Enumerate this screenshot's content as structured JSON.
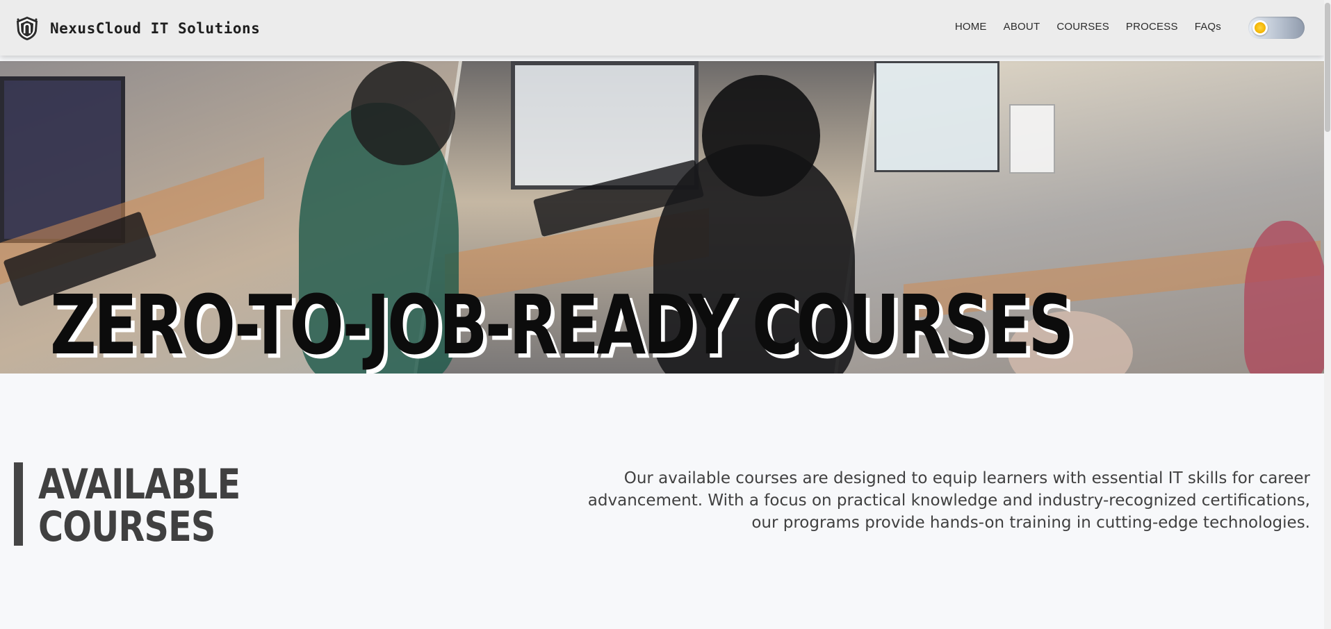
{
  "header": {
    "brand_name": "NexusCloud IT Solutions",
    "logo_icon": "shield-logo-icon",
    "nav": [
      {
        "label": "HOME"
      },
      {
        "label": "ABOUT"
      },
      {
        "label": "COURSES"
      },
      {
        "label": "PROCESS"
      },
      {
        "label": "FAQs"
      }
    ],
    "theme_toggle": {
      "icon": "sun-icon",
      "state": "light",
      "accent": "#f2b200"
    }
  },
  "hero": {
    "title": "ZERO-TO-JOB-READY COURSES",
    "image_description": "Collage of three classroom photos: students working at computers"
  },
  "intro": {
    "title_line1": "AVAILABLE",
    "title_line2": "COURSES",
    "description": "Our available courses are designed to equip learners with essential IT skills for career advancement. With a focus on practical knowledge and industry-recognized certifications, our programs provide hands-on training in cutting-edge technologies."
  },
  "colors": {
    "page_background": "#f7f8fa",
    "header_background": "#ececec",
    "heading_text": "#404040",
    "hero_title": "#0c0c0c"
  }
}
